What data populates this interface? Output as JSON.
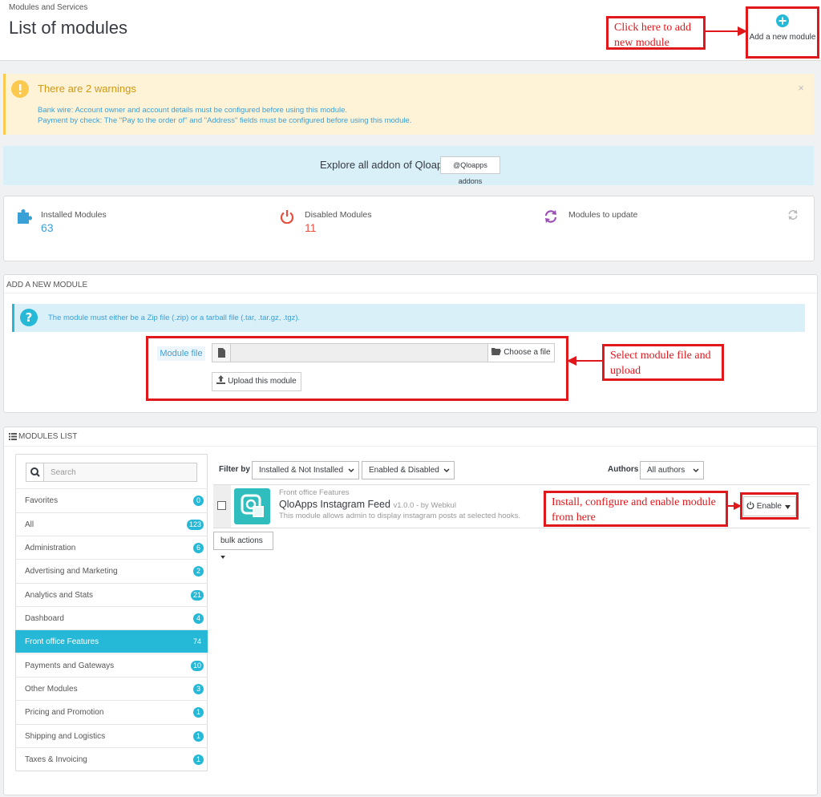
{
  "header": {
    "breadcrumb": "Modules and Services",
    "title": "List of modules",
    "add_module_label": "Add a new module"
  },
  "annotations": {
    "add_module": "Click here to add new module",
    "select_file": "Select module file and upload",
    "install": "Install, configure and enable module from here"
  },
  "warning": {
    "title": "There are 2 warnings",
    "lines": [
      "Bank wire: Account owner and account details must be configured before using this module.",
      "Payment by check: The \"Pay to the order of\" and \"Address\" fields must be configured before using this module."
    ],
    "close": "×"
  },
  "explore": {
    "text": "Explore all addon of Qloapps",
    "button": "@Qloapps addons"
  },
  "kpi": {
    "installed_label": "Installed Modules",
    "installed_value": "63",
    "disabled_label": "Disabled Modules",
    "disabled_value": "11",
    "update_label": "Modules to update"
  },
  "add_new": {
    "heading": "ADD A NEW MODULE",
    "info": "The module must either be a Zip file (.zip) or a tarball file (.tar, .tar.gz, .tgz).",
    "file_label": "Module file",
    "choose": "Choose a file",
    "upload": "Upload this module"
  },
  "modules_list": {
    "heading": "MODULES LIST",
    "search_placeholder": "Search",
    "filter_label": "Filter by",
    "filter_install": "Installed & Not Installed",
    "filter_enabled": "Enabled & Disabled",
    "authors_label": "Authors",
    "authors_value": "All authors",
    "bulk": "bulk actions",
    "categories": [
      {
        "label": "Favorites",
        "count": "0"
      },
      {
        "label": "All",
        "count": "123"
      },
      {
        "label": "Administration",
        "count": "6"
      },
      {
        "label": "Advertising and Marketing",
        "count": "2"
      },
      {
        "label": "Analytics and Stats",
        "count": "21"
      },
      {
        "label": "Dashboard",
        "count": "4"
      },
      {
        "label": "Front office Features",
        "count": "74"
      },
      {
        "label": "Payments and Gateways",
        "count": "10"
      },
      {
        "label": "Other Modules",
        "count": "3"
      },
      {
        "label": "Pricing and Promotion",
        "count": "1"
      },
      {
        "label": "Shipping and Logistics",
        "count": "1"
      },
      {
        "label": "Taxes & Invoicing",
        "count": "1"
      }
    ],
    "module": {
      "category": "Front office Features",
      "name": "QloApps Instagram Feed",
      "version": "v1.0.0 - by Webkul",
      "description": "This module allows admin to display instagram posts at selected hooks.",
      "action": "Enable"
    }
  },
  "colors": {
    "accent": "#25b9d7",
    "annotation": "#e0171b",
    "warning_bg": "#fff3d7",
    "disabled": "#e84e3d"
  }
}
